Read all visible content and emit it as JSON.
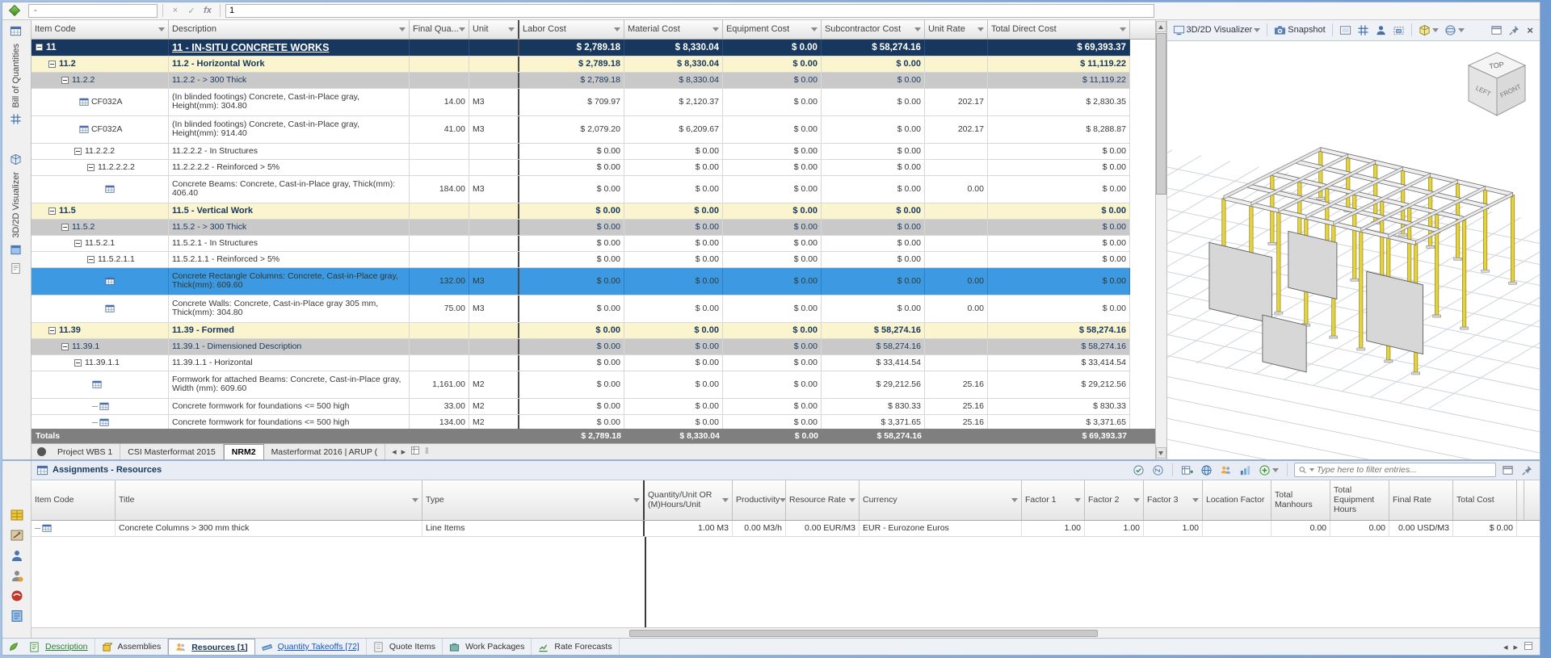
{
  "formula_bar": {
    "name_box_value": "-",
    "cancel_glyph": "×",
    "confirm_glyph": "✓",
    "fx_glyph": "fx",
    "cell_value": "1"
  },
  "left_sidebar": {
    "tabs": [
      {
        "label": "Bill of Quantities"
      },
      {
        "label": "3D/2D Visualizer"
      }
    ]
  },
  "icons": {
    "nav_left": "◂",
    "nav_right": "▸",
    "double_bar": "‖",
    "close": "×"
  },
  "main_grid": {
    "columns": [
      "Item Code",
      "Description",
      "Final Qua...",
      "Unit",
      "Labor Cost",
      "Material Cost",
      "Equipment Cost",
      "Subcontractor Cost",
      "Unit Rate",
      "Total Direct Cost"
    ],
    "rows": [
      {
        "code": "11",
        "desc": "11 - IN-SITU CONCRETE WORKS",
        "labor": "$ 2,789.18",
        "material": "$ 8,330.04",
        "equipment": "$ 0.00",
        "subcontractor": "$ 58,274.16",
        "total": "$ 69,393.37",
        "style": "head",
        "indent": 0,
        "expander": true
      },
      {
        "code": "11.2",
        "desc": "11.2 - Horizontal Work",
        "labor": "$ 2,789.18",
        "material": "$ 8,330.04",
        "equipment": "$ 0.00",
        "subcontractor": "$ 0.00",
        "total": "$ 11,119.22",
        "style": "group1",
        "indent": 1,
        "expander": true
      },
      {
        "code": "11.2.2",
        "desc": "11.2.2 - > 300 Thick",
        "labor": "$ 2,789.18",
        "material": "$ 8,330.04",
        "equipment": "$ 0.00",
        "subcontractor": "$ 0.00",
        "total": "$ 11,119.22",
        "style": "group2",
        "indent": 2,
        "expander": true
      },
      {
        "code": "CF032A",
        "desc": "(In blinded footings) Concrete, Cast-in-Place gray, Height(mm): 304.80",
        "qty": "14.00",
        "unit": "M3",
        "labor": "$ 709.97",
        "material": "$ 2,120.37",
        "equipment": "$ 0.00",
        "subcontractor": "$ 0.00",
        "unit_rate": "202.17",
        "total": "$ 2,830.35",
        "style": "item",
        "indent": 3,
        "icon": true,
        "lines": 2
      },
      {
        "code": "CF032A",
        "desc": "(In blinded footings) Concrete, Cast-in-Place gray, Height(mm): 914.40",
        "qty": "41.00",
        "unit": "M3",
        "labor": "$ 2,079.20",
        "material": "$ 6,209.67",
        "equipment": "$ 0.00",
        "subcontractor": "$ 0.00",
        "unit_rate": "202.17",
        "total": "$ 8,288.87",
        "style": "item",
        "indent": 3,
        "icon": true,
        "lines": 2
      },
      {
        "code": "11.2.2.2",
        "desc": "11.2.2.2 - In Structures",
        "labor": "$ 0.00",
        "material": "$ 0.00",
        "equipment": "$ 0.00",
        "subcontractor": "$ 0.00",
        "total": "$ 0.00",
        "style": "plain",
        "indent": 3,
        "expander": true
      },
      {
        "code": "11.2.2.2.2",
        "desc": "11.2.2.2.2 - Reinforced > 5%",
        "labor": "$ 0.00",
        "material": "$ 0.00",
        "equipment": "$ 0.00",
        "subcontractor": "$ 0.00",
        "total": "$ 0.00",
        "style": "plain",
        "indent": 4,
        "expander": true
      },
      {
        "code": "",
        "desc": "Concrete Beams: Concrete, Cast-in-Place gray, Thick(mm): 406.40",
        "qty": "184.00",
        "unit": "M3",
        "labor": "$ 0.00",
        "material": "$ 0.00",
        "equipment": "$ 0.00",
        "subcontractor": "$ 0.00",
        "unit_rate": "0.00",
        "total": "$ 0.00",
        "style": "item",
        "indent": 5,
        "icon": true,
        "lines": 2
      },
      {
        "code": "11.5",
        "desc": "11.5 - Vertical Work",
        "labor": "$ 0.00",
        "material": "$ 0.00",
        "equipment": "$ 0.00",
        "subcontractor": "$ 0.00",
        "total": "$ 0.00",
        "style": "group1",
        "indent": 1,
        "expander": true
      },
      {
        "code": "11.5.2",
        "desc": "11.5.2 - > 300 Thick",
        "labor": "$ 0.00",
        "material": "$ 0.00",
        "equipment": "$ 0.00",
        "subcontractor": "$ 0.00",
        "total": "$ 0.00",
        "style": "group2",
        "indent": 2,
        "expander": true
      },
      {
        "code": "11.5.2.1",
        "desc": "11.5.2.1 - In Structures",
        "labor": "$ 0.00",
        "material": "$ 0.00",
        "equipment": "$ 0.00",
        "subcontractor": "$ 0.00",
        "total": "$ 0.00",
        "style": "plain",
        "indent": 3,
        "expander": true
      },
      {
        "code": "11.5.2.1.1",
        "desc": "11.5.2.1.1 - Reinforced > 5%",
        "labor": "$ 0.00",
        "material": "$ 0.00",
        "equipment": "$ 0.00",
        "subcontractor": "$ 0.00",
        "total": "$ 0.00",
        "style": "plain",
        "indent": 4,
        "expander": true
      },
      {
        "code": "",
        "desc": "Concrete Rectangle Columns: Concrete, Cast-in-Place gray, Thick(mm): 609.60",
        "qty": "132.00",
        "unit": "M3",
        "labor": "$ 0.00",
        "material": "$ 0.00",
        "equipment": "$ 0.00",
        "subcontractor": "$ 0.00",
        "unit_rate": "0.00",
        "total": "$ 0.00",
        "style": "selected",
        "indent": 5,
        "icon": true,
        "lines": 2
      },
      {
        "code": "",
        "desc": "Concrete Walls: Concrete, Cast-in-Place gray 305 mm, Thick(mm): 304.80",
        "qty": "75.00",
        "unit": "M3",
        "labor": "$ 0.00",
        "material": "$ 0.00",
        "equipment": "$ 0.00",
        "subcontractor": "$ 0.00",
        "unit_rate": "0.00",
        "total": "$ 0.00",
        "style": "item",
        "indent": 5,
        "icon": true,
        "lines": 2
      },
      {
        "code": "11.39",
        "desc": "11.39 - Formed",
        "labor": "$ 0.00",
        "material": "$ 0.00",
        "equipment": "$ 0.00",
        "subcontractor": "$ 58,274.16",
        "total": "$ 58,274.16",
        "style": "group1",
        "indent": 1,
        "expander": true
      },
      {
        "code": "11.39.1",
        "desc": "11.39.1 - Dimensioned Description",
        "labor": "$ 0.00",
        "material": "$ 0.00",
        "equipment": "$ 0.00",
        "subcontractor": "$ 58,274.16",
        "total": "$ 58,274.16",
        "style": "group2",
        "indent": 2,
        "expander": true
      },
      {
        "code": "11.39.1.1",
        "desc": "11.39.1.1 - Horizontal",
        "labor": "$ 0.00",
        "material": "$ 0.00",
        "equipment": "$ 0.00",
        "subcontractor": "$ 33,414.54",
        "total": "$ 33,414.54",
        "style": "plain",
        "indent": 3,
        "expander": true
      },
      {
        "code": "",
        "desc": "Formwork for attached Beams: Concrete, Cast-in-Place gray, Width (mm): 609.60",
        "qty": "1,161.00",
        "unit": "M2",
        "labor": "$ 0.00",
        "material": "$ 0.00",
        "equipment": "$ 0.00",
        "subcontractor": "$ 29,212.56",
        "unit_rate": "25.16",
        "total": "$ 29,212.56",
        "style": "item",
        "indent": 4,
        "icon": true,
        "lines": 2
      },
      {
        "code": "",
        "desc": "Concrete formwork for foundations <= 500 high",
        "qty": "33.00",
        "unit": "M2",
        "labor": "$ 0.00",
        "material": "$ 0.00",
        "equipment": "$ 0.00",
        "subcontractor": "$ 830.33",
        "unit_rate": "25.16",
        "total": "$ 830.33",
        "style": "item",
        "indent": 4,
        "icon": true,
        "dash": true
      },
      {
        "code": "",
        "desc": "Concrete formwork for foundations <= 500 high",
        "qty": "134.00",
        "unit": "M2",
        "labor": "$ 0.00",
        "material": "$ 0.00",
        "equipment": "$ 0.00",
        "subcontractor": "$ 3,371.65",
        "unit_rate": "25.16",
        "total": "$ 3,371.65",
        "style": "item",
        "indent": 4,
        "icon": true,
        "dash": true
      }
    ],
    "totals": {
      "label": "Totals",
      "labor": "$ 2,789.18",
      "material": "$ 8,330.04",
      "equipment": "$ 0.00",
      "subcontractor": "$ 58,274.16",
      "total": "$ 69,393.37"
    },
    "sheet_tabs": {
      "active": "NRM2",
      "tabs": [
        "Project WBS 1",
        "CSI Masterformat 2015",
        "NRM2",
        "Masterformat 2016 | ARUP ("
      ]
    }
  },
  "visualizer": {
    "title": "3D/2D Visualizer",
    "snapshot_label": "Snapshot",
    "view_cube": {
      "top": "TOP",
      "left": "LEFT",
      "front": "FRONT"
    }
  },
  "assignments": {
    "title": "Assignments - Resources",
    "filter_placeholder": "Type here to filter entries...",
    "columns": [
      "Item Code",
      "Title",
      "Type",
      "Quantity/Unit OR (M)Hours/Unit",
      "Productivity",
      "Resource Rate",
      "Currency",
      "Factor 1",
      "Factor 2",
      "Factor 3",
      "Location Factor",
      "Total Manhours",
      "Total Equipment Hours",
      "Final Rate",
      "Total Cost"
    ],
    "rows": [
      {
        "item_code": "",
        "title": "Concrete Columns > 300 mm thick",
        "type": "Line Items",
        "qty": "1.00 M3",
        "productivity": "0.00 M3/h",
        "rate": "0.00 EUR/M3",
        "currency": "EUR - Eurozone Euros",
        "f1": "1.00",
        "f2": "1.00",
        "f3": "1.00",
        "loc": "",
        "manhours": "0.00",
        "equip_hours": "0.00",
        "final_rate": "0.00 USD/M3",
        "total": "$ 0.00"
      }
    ]
  },
  "bottom_tabs": {
    "active": "Resources [1]",
    "tabs": [
      {
        "label": "Description"
      },
      {
        "label": "Assemblies"
      },
      {
        "label": "Resources [1]"
      },
      {
        "label": "Quantity Takeoffs [72]"
      },
      {
        "label": "Quote Items"
      },
      {
        "label": "Work Packages"
      },
      {
        "label": "Rate Forecasts"
      }
    ]
  }
}
